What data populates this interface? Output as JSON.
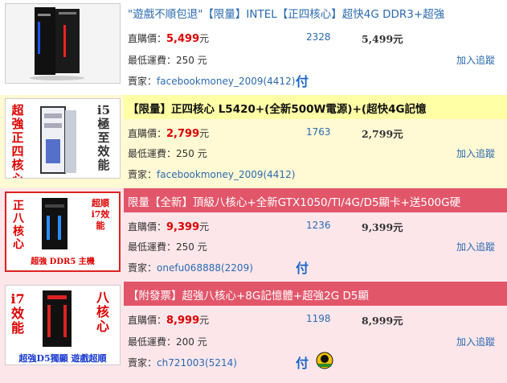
{
  "labels": {
    "direct_price": "直購價：",
    "min_shipping": "最低運費：",
    "seller": "賣家：",
    "add_track": "加入追蹤"
  },
  "listings": [
    {
      "title": "\"遊戲不順包退\"【限量】INTEL【正四核心】超快4G DDR3+超強",
      "price": "5,499",
      "price_unit": "元",
      "qty": "2328",
      "price2": "5,499元",
      "shipping": "250 元",
      "seller": "facebookmoney_2009(4412)",
      "badge_fu": "付"
    },
    {
      "title": "【限量】正四核心 L5420+(全新500W電源)+(超快4G記憶",
      "price": "2,799",
      "price_unit": "元",
      "qty": "1763",
      "price2": "2,799元",
      "shipping": "250 元",
      "seller": "facebookmoney_2009(4412)",
      "thumb_left": "超強正四核心",
      "thumb_right": "i5極至效能"
    },
    {
      "title": "限量【全新】頂級八核心+全新GTX1050/TI/4G/D5顯卡+送500G硬",
      "price": "9,399",
      "price_unit": "元",
      "qty": "1236",
      "price2": "9,399元",
      "shipping": "250 元",
      "seller": "onefu068888(2209)",
      "badge_fu": "付",
      "thumb_left": "正八核心",
      "thumb_right": "超順i7效能",
      "thumb_bottom": "超強 DDR5 主機"
    },
    {
      "title": "【附發票】超強八核心+8G記憶體+超強2G D5顯",
      "price": "8,999",
      "price_unit": "元",
      "qty": "1198",
      "price2": "8,999元",
      "shipping": "200 元",
      "seller": "ch721003(5214)",
      "badge_fu": "付",
      "thumb_left": "i7效能",
      "thumb_right": "八核心",
      "thumb_bottom": "超強D5獨顯 遊戲超順"
    }
  ],
  "colors": {
    "link": "#2a6ab0",
    "price_red": "#dd0000",
    "yellow_band": "#ffffa6",
    "pink_band": "#e2566a",
    "pink_bg": "#fde6ea"
  }
}
